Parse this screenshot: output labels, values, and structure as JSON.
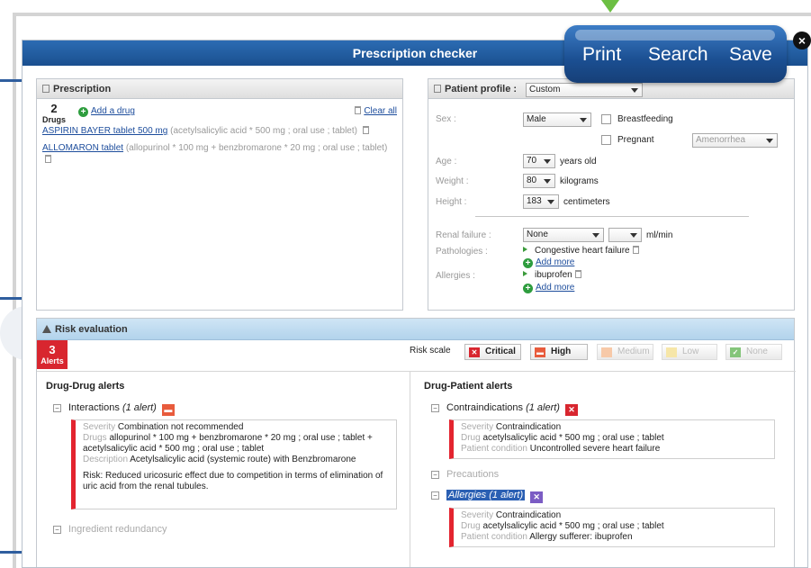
{
  "window": {
    "title": "Prescription checker"
  },
  "toolbar": {
    "print": "Print",
    "search": "Search",
    "save": "Save",
    "close": "×"
  },
  "prescription": {
    "title": "Prescription",
    "count": "2",
    "count_label": "Drugs",
    "add_drug": "Add a drug",
    "clear_all": "Clear all",
    "drugs": [
      {
        "name": "ASPIRIN BAYER tablet 500 mg",
        "desc": "(acetylsalicylic acid * 500 mg ; oral use ; tablet)"
      },
      {
        "name": "ALLOMARON tablet",
        "desc": "(allopurinol * 100 mg + benzbromarone * 20 mg ; oral use ; tablet)"
      }
    ]
  },
  "patient": {
    "title": "Patient profile :",
    "profile_value": "Custom",
    "sex_label": "Sex :",
    "sex_value": "Male",
    "breastfeeding": "Breastfeeding",
    "pregnant": "Pregnant",
    "amenorrhea": "Amenorrhea",
    "age_label": "Age :",
    "age_value": "70",
    "age_unit": "years old",
    "weight_label": "Weight :",
    "weight_value": "80",
    "weight_unit": "kilograms",
    "height_label": "Height :",
    "height_value": "183",
    "height_unit": "centimeters",
    "renal_label": "Renal failure :",
    "renal_value": "None",
    "renal_unit": "ml/min",
    "pathologies_label": "Pathologies :",
    "pathology_item": "Congestive heart failure",
    "allergies_label": "Allergies :",
    "allergy_item": "ibuprofen",
    "add_more": "Add more"
  },
  "risk": {
    "title": "Risk evaluation",
    "alerts_count": "3",
    "alerts_label": "Alerts",
    "scale_label": "Risk scale",
    "scale": {
      "critical": "Critical",
      "high": "High",
      "medium": "Medium",
      "low": "Low",
      "none": "None"
    },
    "colors": {
      "critical": "#d8262f",
      "high": "#e85b3c",
      "medium": "#f7c9a8",
      "low": "#f6e6a8",
      "none": "#84c57a",
      "allergy": "#7b5cc4"
    },
    "drug_drug": {
      "title": "Drug-Drug alerts",
      "interactions": "Interactions",
      "interactions_count": "(1 alert)",
      "severity_k": "Severity",
      "severity_v": "Combination not recommended",
      "drugs_k": "Drugs",
      "drugs_v": "allopurinol * 100 mg + benzbromarone * 20 mg ; oral use ; tablet + acetylsalicylic acid * 500 mg ; oral use ; tablet",
      "desc_k": "Description",
      "desc_v": "Acetylsalicylic acid (systemic route) with Benzbromarone",
      "risk_text": "Risk: Reduced uricosuric effect due to competition in terms of elimination of uric acid from the renal tubules.",
      "redundancy": "Ingredient redundancy"
    },
    "drug_patient": {
      "title": "Drug-Patient alerts",
      "contra": "Contraindications",
      "contra_count": "(1 alert)",
      "severity_k": "Severity",
      "severity_v": "Contraindication",
      "drug_k": "Drug",
      "drug_v": "acetylsalicylic acid * 500 mg ; oral use ; tablet",
      "cond_k": "Patient condition",
      "cond_v": "Uncontrolled severe heart failure",
      "precautions": "Precautions",
      "allergies": "Allergies",
      "allergies_count": "(1 alert)",
      "a_severity_v": "Contraindication",
      "a_drug_v": "acetylsalicylic acid * 500 mg ; oral use ; tablet",
      "a_cond_v": "Allergy sufferer: ibuprofen"
    }
  }
}
